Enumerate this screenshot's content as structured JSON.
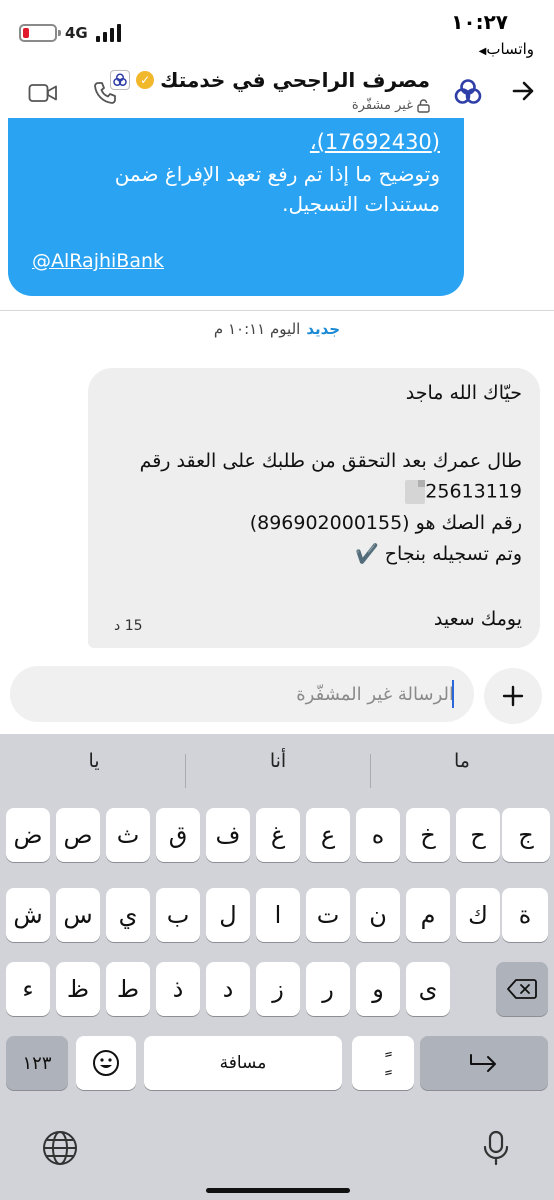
{
  "status_bar": {
    "time": "١٠:٢٧",
    "back_app": "واتساب",
    "network": "4G",
    "battery_level": 0.2
  },
  "header": {
    "title": "مصرف الراجحي في خدمتك",
    "subtitle": "غير مشفّرة",
    "colors": {
      "logo": "#2f3fa8",
      "verified": "#f2b82c"
    }
  },
  "messages": {
    "top_bubble": {
      "ref": "(17692430)،",
      "line1": "وتوضيح ما إذا تم رفع تعهد الإفراغ ضمن",
      "line2": "مستندات التسجيل.",
      "handle": "@AlRajhiBank",
      "color": "#29a3f2"
    },
    "separator": {
      "new_label": "جديد",
      "date_label": "اليوم ١٠:١١ م"
    },
    "incoming": {
      "greeting": "حيّاك الله ماجد",
      "line1": "طال عمرك بعد التحقق من طلبك على العقد رقم",
      "contract_no": "25613119",
      "line3": "رقم الصك هو (896902000155)",
      "line4": "وتم تسجيله بنجاح ✔️",
      "closing": "يومك سعيد",
      "timer": "15 د"
    }
  },
  "composer": {
    "placeholder": "الرسالة غير المشفّرة"
  },
  "keyboard": {
    "suggestions": [
      "ما",
      "أنا",
      "يا"
    ],
    "row1": [
      "ج",
      "ح",
      "خ",
      "ه",
      "ع",
      "غ",
      "ف",
      "ق",
      "ث",
      "ص",
      "ض"
    ],
    "row2": [
      "ة",
      "ك",
      "م",
      "ن",
      "ت",
      "ا",
      "ل",
      "ب",
      "ي",
      "س",
      "ش"
    ],
    "row3": [
      "ى",
      "و",
      "ر",
      "ز",
      "د",
      "ذ",
      "ط",
      "ظ",
      "ء"
    ],
    "numbers_label": "١٢٣",
    "space_label": "مسافة",
    "tanween_label": "ًٍ"
  }
}
